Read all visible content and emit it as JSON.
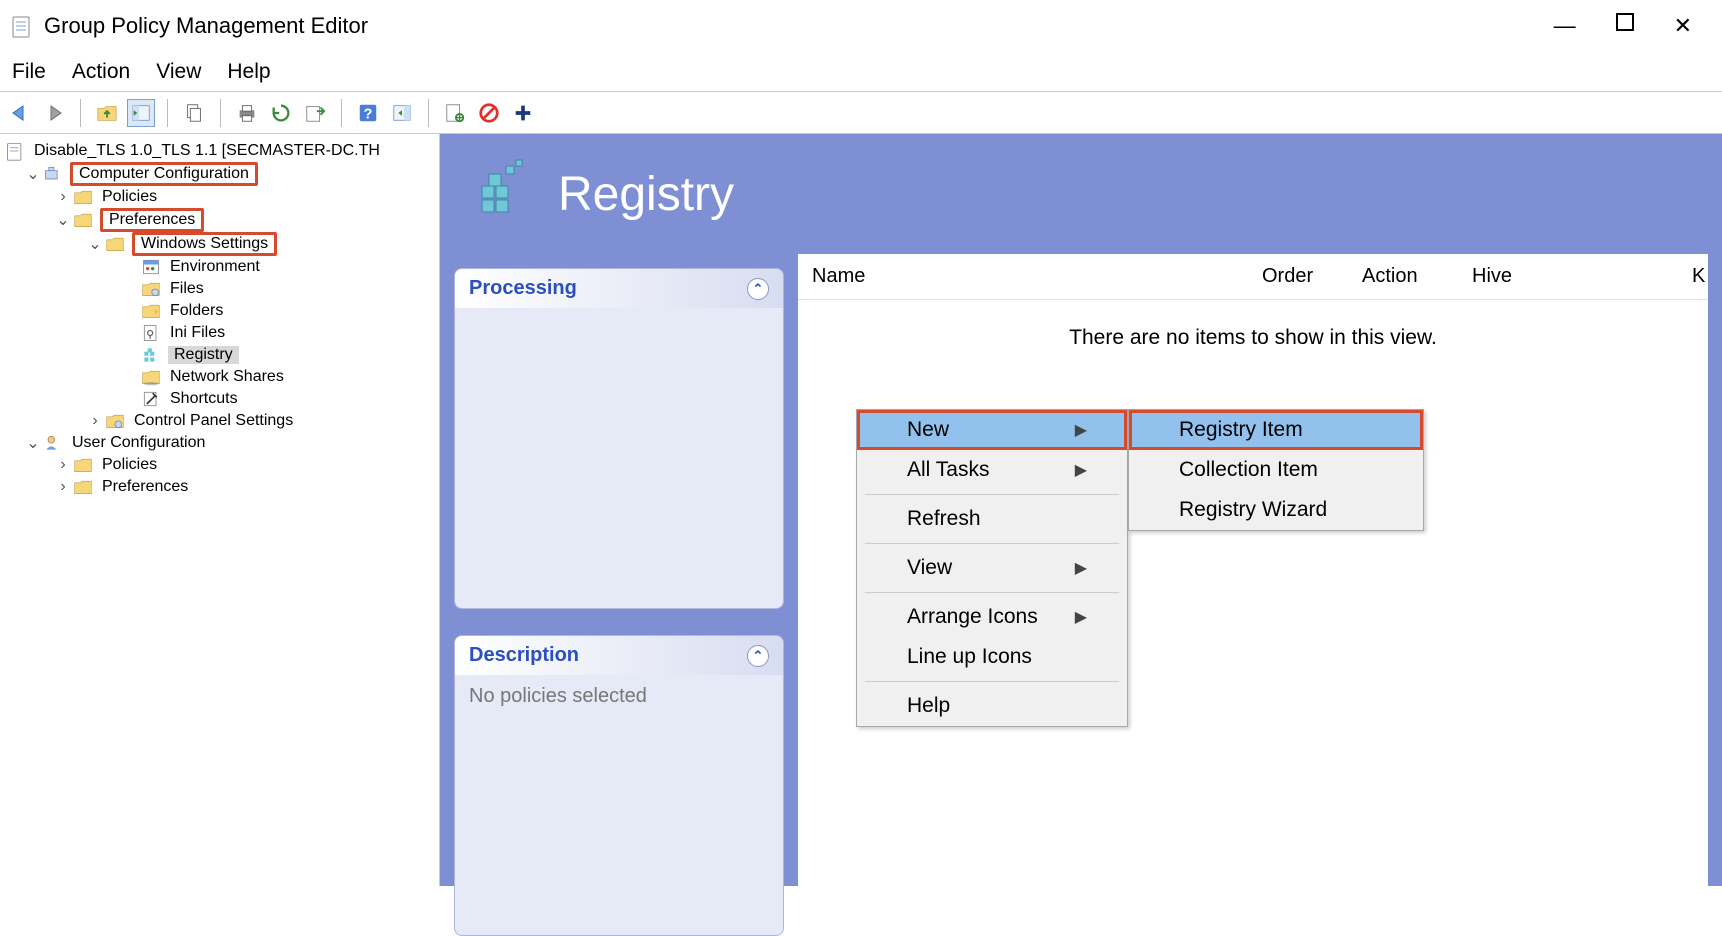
{
  "window": {
    "title": "Group Policy Management Editor"
  },
  "menubar": [
    "File",
    "Action",
    "View",
    "Help"
  ],
  "tree": {
    "root": "Disable_TLS 1.0_TLS 1.1 [SECMASTER-DC.TH",
    "computer_config": "Computer Configuration",
    "policies1": "Policies",
    "preferences": "Preferences",
    "windows_settings": "Windows Settings",
    "environment": "Environment",
    "files": "Files",
    "folders": "Folders",
    "ini_files": "Ini Files",
    "registry": "Registry",
    "network_shares": "Network Shares",
    "shortcuts": "Shortcuts",
    "control_panel": "Control Panel Settings",
    "user_config": "User Configuration",
    "policies2": "Policies",
    "preferences2": "Preferences"
  },
  "content": {
    "title": "Registry",
    "panel1_title": "Processing",
    "panel2_title": "Description",
    "panel2_text": "No policies selected"
  },
  "list": {
    "col_name": "Name",
    "col_order": "Order",
    "col_action": "Action",
    "col_hive": "Hive",
    "col_k": "K",
    "empty": "There are no items to show in this view."
  },
  "ctx1": {
    "new": "New",
    "all_tasks": "All Tasks",
    "refresh": "Refresh",
    "view": "View",
    "arrange": "Arrange Icons",
    "lineup": "Line up Icons",
    "help": "Help"
  },
  "ctx2": {
    "reg_item": "Registry Item",
    "coll_item": "Collection Item",
    "reg_wizard": "Registry Wizard"
  }
}
